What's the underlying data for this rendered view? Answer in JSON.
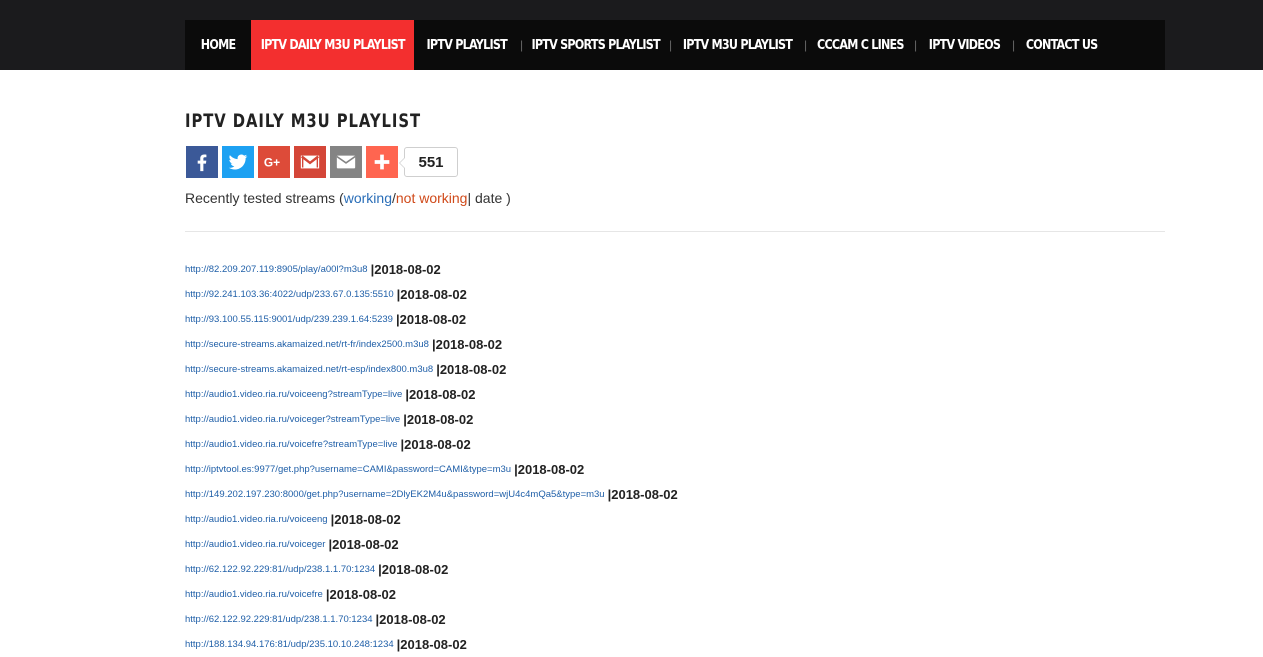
{
  "nav": {
    "items": [
      {
        "label": "HOME",
        "active": false
      },
      {
        "label": "IPTV DAILY M3U PLAYLIST",
        "active": true
      },
      {
        "label": "IPTV PLAYLIST",
        "active": false
      },
      {
        "label": "IPTV SPORTS PLAYLIST",
        "active": false
      },
      {
        "label": "IPTV M3U PLAYLIST",
        "active": false
      },
      {
        "label": "CCCAM C LINES",
        "active": false
      },
      {
        "label": "IPTV VIDEOS",
        "active": false
      },
      {
        "label": "CONTACT US",
        "active": false
      }
    ],
    "separator": "|",
    "accent_color": "#f32f2f"
  },
  "page": {
    "title": "IPTV DAILY M3U PLAYLIST"
  },
  "share": {
    "buttons": [
      {
        "name": "facebook",
        "icon": "facebook-icon",
        "color": "#3b5998"
      },
      {
        "name": "twitter",
        "icon": "twitter-icon",
        "color": "#1da1f2"
      },
      {
        "name": "google-plus",
        "icon": "google-plus-icon",
        "color": "#dd4b39"
      },
      {
        "name": "gmail",
        "icon": "gmail-icon",
        "color": "#d44638"
      },
      {
        "name": "email",
        "icon": "email-icon",
        "color": "#848484"
      },
      {
        "name": "more",
        "icon": "plus-icon",
        "color": "#ff6550"
      }
    ],
    "count": "551"
  },
  "legend": {
    "prefix": "Recently tested streams (",
    "working": "working",
    "slash": "/",
    "not_working": "not working",
    "suffix": "| date )"
  },
  "streams": [
    {
      "url": "http://82.209.207.119:8905/play/a00l?m3u8",
      "date": "|2018-08-02"
    },
    {
      "url": "http://92.241.103.36:4022/udp/233.67.0.135:5510",
      "date": "|2018-08-02"
    },
    {
      "url": "http://93.100.55.115:9001/udp/239.239.1.64:5239",
      "date": "|2018-08-02"
    },
    {
      "url": "http://secure-streams.akamaized.net/rt-fr/index2500.m3u8",
      "date": "|2018-08-02"
    },
    {
      "url": "http://secure-streams.akamaized.net/rt-esp/index800.m3u8",
      "date": "|2018-08-02"
    },
    {
      "url": "http://audio1.video.ria.ru/voiceeng?streamType=live",
      "date": "|2018-08-02"
    },
    {
      "url": "http://audio1.video.ria.ru/voiceger?streamType=live",
      "date": "|2018-08-02"
    },
    {
      "url": "http://audio1.video.ria.ru/voicefre?streamType=live",
      "date": "|2018-08-02"
    },
    {
      "url": "http://iptvtool.es:9977/get.php?username=CAMI&password=CAMI&type=m3u",
      "date": "|2018-08-02"
    },
    {
      "url": "http://149.202.197.230:8000/get.php?username=2DlyEK2M4u&password=wjU4c4mQa5&type=m3u",
      "date": "|2018-08-02"
    },
    {
      "url": "http://audio1.video.ria.ru/voiceeng",
      "date": "|2018-08-02"
    },
    {
      "url": "http://audio1.video.ria.ru/voiceger",
      "date": "|2018-08-02"
    },
    {
      "url": "http://62.122.92.229:81//udp/238.1.1.70:1234",
      "date": "|2018-08-02"
    },
    {
      "url": "http://audio1.video.ria.ru/voicefre",
      "date": "|2018-08-02"
    },
    {
      "url": "http://62.122.92.229:81/udp/238.1.1.70:1234",
      "date": "|2018-08-02"
    },
    {
      "url": "http://188.134.94.176:81/udp/235.10.10.248:1234",
      "date": "|2018-08-02"
    }
  ]
}
